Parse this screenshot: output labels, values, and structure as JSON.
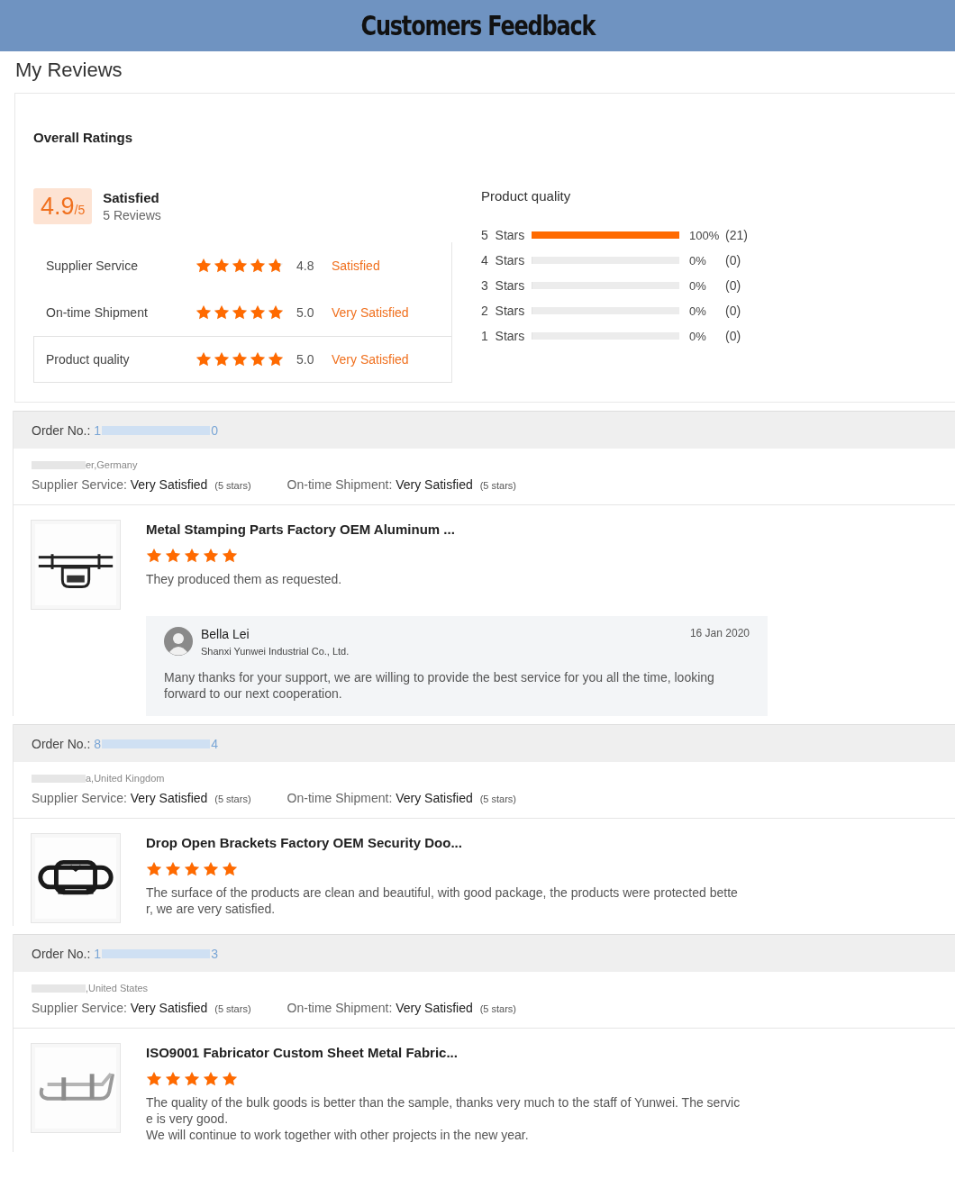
{
  "header": {
    "title": "Customers Feedback"
  },
  "page_title": "My Reviews",
  "overall": {
    "title": "Overall Ratings",
    "score": "4.9",
    "out_of": "/5",
    "verdict": "Satisfied",
    "review_count": "5 Reviews",
    "criteria": [
      {
        "label": "Supplier Service",
        "stars": 4.8,
        "score": "4.8",
        "verdict": "Satisfied",
        "selected": false
      },
      {
        "label": "On-time Shipment",
        "stars": 5,
        "score": "5.0",
        "verdict": "Very Satisfied",
        "selected": false
      },
      {
        "label": "Product quality",
        "stars": 5,
        "score": "5.0",
        "verdict": "Very Satisfied",
        "selected": true
      }
    ]
  },
  "breakdown": {
    "title": "Product quality",
    "rows": [
      {
        "label": "5  Stars",
        "level": 1,
        "percent": "100%",
        "count": "(21)"
      },
      {
        "label": "4  Stars",
        "level": 0,
        "percent": "0%",
        "count": "(0)"
      },
      {
        "label": "3  Stars",
        "level": 0,
        "percent": "0%",
        "count": "(0)"
      },
      {
        "label": "2  Stars",
        "level": 0,
        "percent": "0%",
        "count": "(0)"
      },
      {
        "label": "1  Stars",
        "level": 0,
        "percent": "0%",
        "count": "(0)"
      }
    ]
  },
  "orders": [
    {
      "order_label": "Order No.:",
      "order_number_start": "1",
      "order_number_end": "0",
      "location": "er,Germany",
      "supplier_label": "Supplier Service:",
      "supplier_value": "Very Satisfied",
      "supplier_stars": "(5 stars)",
      "shipment_label": "On-time Shipment:",
      "shipment_value": "Very Satisfied",
      "shipment_stars": "(5 stars)",
      "product_title": "Metal Stamping Parts Factory OEM Aluminum ...",
      "stars": 5,
      "review": "They produced them as requested.",
      "reply": {
        "name": "Bella Lei",
        "company": "Shanxi Yunwei Industrial Co., Ltd.",
        "date": "16 Jan 2020",
        "text": "Many thanks for your support, we are willing to provide the best service for you all the time, looking forward to our next cooperation."
      }
    },
    {
      "order_label": "Order No.:",
      "order_number_start": "8",
      "order_number_end": "4",
      "location": "a,United Kingdom",
      "supplier_label": "Supplier Service:",
      "supplier_value": "Very Satisfied",
      "supplier_stars": "(5 stars)",
      "shipment_label": "On-time Shipment:",
      "shipment_value": "Very Satisfied",
      "shipment_stars": "(5 stars)",
      "product_title": "Drop Open Brackets Factory OEM Security Doo...",
      "stars": 5,
      "review": "The surface of the products are clean and beautiful, with good package, the products were protected bette\nr, we are very satisfied."
    },
    {
      "order_label": "Order No.:",
      "order_number_start": "1",
      "order_number_end": "3",
      "location": ",United States",
      "supplier_label": "Supplier Service:",
      "supplier_value": "Very Satisfied",
      "supplier_stars": "(5 stars)",
      "shipment_label": "On-time Shipment:",
      "shipment_value": "Very Satisfied",
      "shipment_stars": "(5 stars)",
      "product_title": "ISO9001 Fabricator Custom Sheet Metal Fabric...",
      "stars": 5,
      "review": "The quality of the bulk goods is better than the sample, thanks very much to the staff of Yunwei. The servic\ne is very good.\nWe will continue to work together with other projects in the new year."
    }
  ]
}
